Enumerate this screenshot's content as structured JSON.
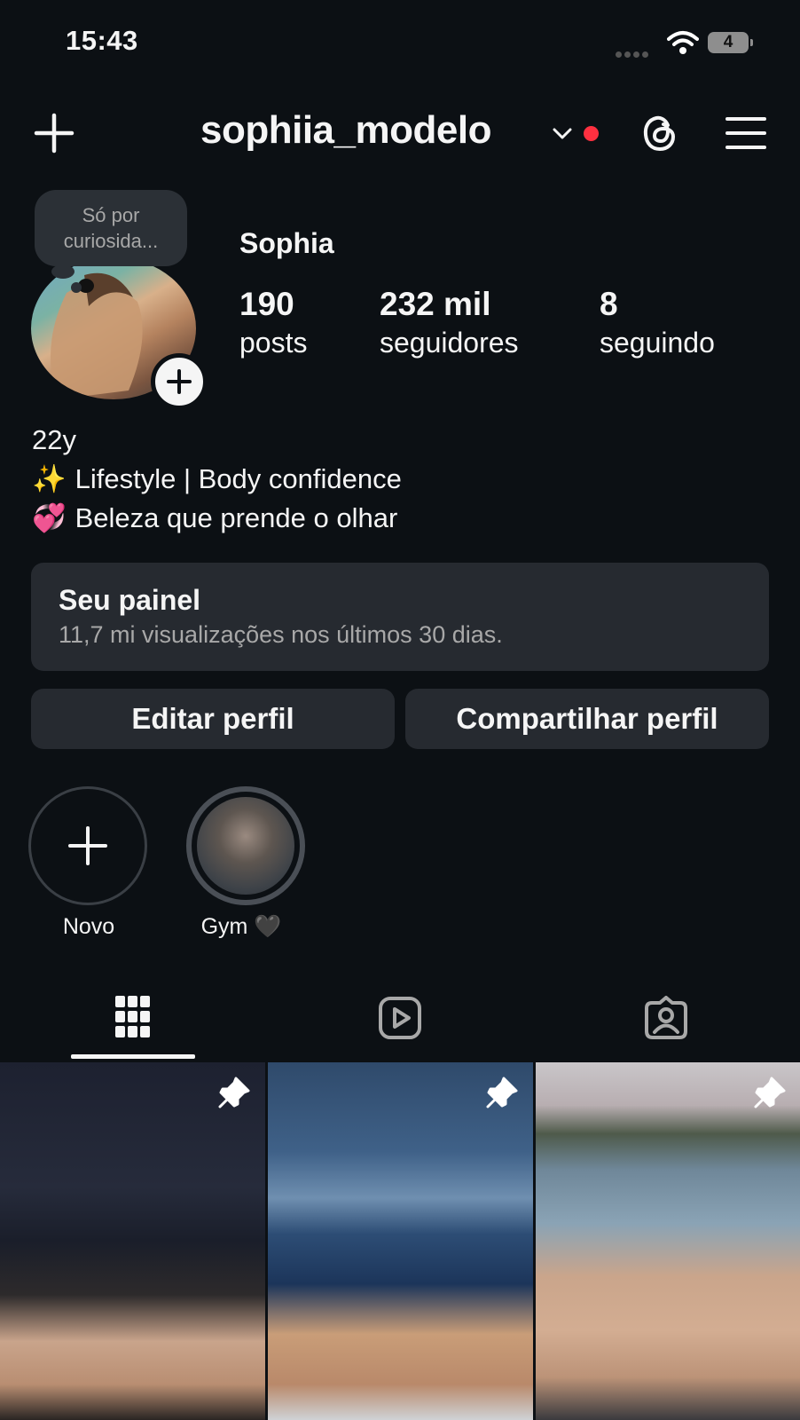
{
  "status_bar": {
    "time": "15:43",
    "battery": "4"
  },
  "header": {
    "username": "sophiia_modelo"
  },
  "profile": {
    "note": "Só por curiosida...",
    "display_name": "Sophia",
    "stats": [
      {
        "value": "190",
        "label": "posts"
      },
      {
        "value": "232 mil",
        "label": "seguidores"
      },
      {
        "value": "8",
        "label": "seguindo"
      }
    ],
    "bio": [
      {
        "emoji": "",
        "text": "22y"
      },
      {
        "emoji": "✨",
        "text": "Lifestyle | Body confidence"
      },
      {
        "emoji": "💞",
        "text": "Beleza que prende o olhar"
      }
    ]
  },
  "dashboard": {
    "title": "Seu painel",
    "subtitle": "11,7 mi visualizações nos últimos 30 dias."
  },
  "actions": {
    "edit": "Editar perfil",
    "share": "Compartilhar perfil"
  },
  "highlights": [
    {
      "label": "Novo"
    },
    {
      "label": "Gym 🖤"
    }
  ],
  "tabs": [
    "grid-icon",
    "reels-icon",
    "tagged-icon"
  ],
  "colors": {
    "background": "#0c1014",
    "surface": "#262a30",
    "notification": "#ff3040"
  }
}
